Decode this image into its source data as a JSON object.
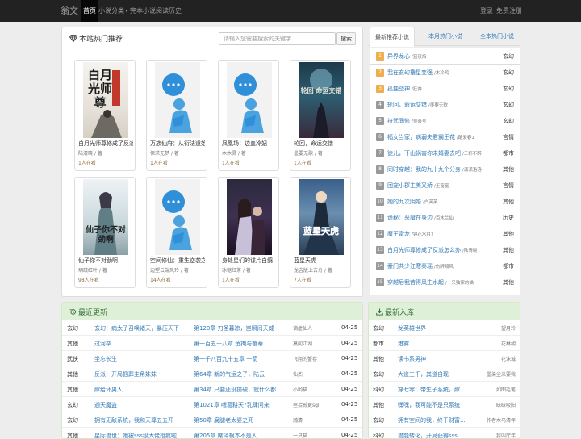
{
  "nav": {
    "brand": "翁文",
    "links": [
      "首页",
      "小说分类",
      "完本小说",
      "阅读历史"
    ],
    "login": "登录",
    "register": "免费注册"
  },
  "hot": {
    "title": "本站热门推荐",
    "search_placeholder": "请输入您需要搜索的关键字",
    "search_button": "搜索",
    "books": [
      {
        "title": "白月光师尊修成了反派么",
        "author": "陆清晓 / 著",
        "readers": "1人在看",
        "cover_text": "白月光师尊"
      },
      {
        "title": "万族仙府：从衍法道始",
        "author": "但求无梦 / 著",
        "readers": "1人在看",
        "cover_text": ""
      },
      {
        "title": "凤凰场：边血冷妃",
        "author": "木木灵 / 著",
        "readers": "1人在看",
        "cover_text": ""
      },
      {
        "title": "轮回，命运交错",
        "author": "墨要无歌 / 著",
        "readers": "1人在看",
        "cover_text": "轮回 命运交错"
      },
      {
        "title": "仙子你不对劲啊",
        "author": "玥疏红叶 / 著",
        "readers": "98人在看",
        "cover_text": "仙子你不对劲啊"
      },
      {
        "title": "空间修仙：重生逆袭之旅",
        "author": "边塑云端风玲 / 著",
        "readers": "14人在看",
        "cover_text": ""
      },
      {
        "title": "身处星们的谍片白鸽",
        "author": "冰糖红茶 / 著",
        "readers": "1人在看",
        "cover_text": ""
      },
      {
        "title": "蓝星天虎",
        "author": "龙吉版上古舟 / 著",
        "readers": "7人在看",
        "cover_text": "蓝星天虎"
      }
    ]
  },
  "rank": {
    "tabs": [
      "最新推荐小说",
      "本月热门小说",
      "全本热门小说"
    ],
    "items": [
      {
        "num": "1",
        "title": "异界龙心",
        "author": "/蓝夜焰",
        "cat": "玄幻"
      },
      {
        "num": "2",
        "title": "我在玄幻撸星变强",
        "author": "/木冷鸡",
        "cat": "玄幻"
      },
      {
        "num": "3",
        "title": "孤独战神",
        "author": "/狂奔",
        "cat": "玄幻"
      },
      {
        "num": "4",
        "title": "轮回，命运交错",
        "author": "/墨要无歌",
        "cat": "玄幻"
      },
      {
        "num": "5",
        "title": "符武同修",
        "author": "/良善号",
        "cat": "玄幻"
      },
      {
        "num": "6",
        "title": "福女当家，病弱夫君霸王花",
        "author": "/酷爱春1",
        "cat": "言情"
      },
      {
        "num": "7",
        "title": "徒儿，下山祸害你未婚妻去吧",
        "author": "/三杯不醉",
        "cat": "都市"
      },
      {
        "num": "8",
        "title": "同时穿越：我的九十九个分身",
        "author": "/潇潇洛洛",
        "cat": "其他"
      },
      {
        "num": "9",
        "title": "团宠小郡主美又娇",
        "author": "/王富富",
        "cat": "言情"
      },
      {
        "num": "10",
        "title": "她的九次阴婚",
        "author": "/白芙芙",
        "cat": "其他"
      },
      {
        "num": "11",
        "title": "诡秘：恶魔在身边",
        "author": "/百木兰仙",
        "cat": "历史"
      },
      {
        "num": "12",
        "title": "魔王雷龙",
        "author": "/镜花水月?",
        "cat": "其他"
      },
      {
        "num": "13",
        "title": "白月光师尊修成了反派怎么办",
        "author": "/陆清晓",
        "cat": "其他"
      },
      {
        "num": "14",
        "title": "豪门共少江寒秦瑶",
        "author": "/伤醉殴风",
        "cat": "都市"
      },
      {
        "num": "15",
        "title": "穿越后我苦得风生水起",
        "author": "/一只独家的猫",
        "cat": "其他"
      }
    ]
  },
  "updates": {
    "title": "最近更新",
    "rows": [
      {
        "cat": "玄幻",
        "title": "玄幻：病太子召唤诸天，暴压天下",
        "chapter": "第120章 刀圣暮凉，岂瞬间天威",
        "author": "谪虚仙人",
        "date": "04-25"
      },
      {
        "cat": "其他",
        "title": "过河卒",
        "chapter": "第一百五十八章 鱼掩与蟹蒂",
        "author": "莫问江湖",
        "date": "04-25"
      },
      {
        "cat": "武侠",
        "title": "坐忘长生",
        "chapter": "第一千八百九十五章 一箭",
        "author": "飞翔的蟹卷",
        "date": "04-25"
      },
      {
        "cat": "其他",
        "title": "反派：开局掴葬主角妹妹",
        "chapter": "第64章 新的气运之子，陆云",
        "author": "仙杰",
        "date": "04-25"
      },
      {
        "cat": "其他",
        "title": "嫁给坏男人",
        "chapter": "第34章 只要还没撞破，就什么都...",
        "author": "小哟猫",
        "date": "04-25"
      },
      {
        "cat": "玄幻",
        "title": "通天魔盗",
        "chapter": "第1021章 嗜葛耕天?乳肆问来",
        "author": "叁拾贰更sgl",
        "date": "04-25"
      },
      {
        "cat": "玄幻",
        "title": "拥有无敌系统，我和天尊五五开",
        "chapter": "第50章 腐腿老太婆之死",
        "author": "瀚清",
        "date": "04-25"
      },
      {
        "cat": "其他",
        "title": "星际兽世：她被sss级大佬抢疯啦!",
        "chapter": "第205章 席泽根本不是人",
        "author": "一只猫",
        "date": "04-25"
      }
    ]
  },
  "latest": {
    "title": "最新入库",
    "rows": [
      {
        "cat": "玄幻",
        "title": "龙英雄世界",
        "author": "望月玲"
      },
      {
        "cat": "都市",
        "title": "港雾",
        "author": "花林胡"
      },
      {
        "cat": "其他",
        "title": "读书系男神",
        "author": "花沫城"
      },
      {
        "cat": "玄幻",
        "title": "大道三千，其道自现",
        "author": "墨染尘米要我"
      },
      {
        "cat": "科幻",
        "title": "穿七零：带生子系统，嫁...",
        "author": "如图毛笔"
      },
      {
        "cat": "其他",
        "title": "嘿嘿，我可能不是只系统",
        "author": "昧昧吸阳"
      },
      {
        "cat": "玄幻",
        "title": "拥有空间的我，终于财富...",
        "author": "作者木马清年"
      },
      {
        "cat": "科幻",
        "title": "兽能转化，开局获得sss...",
        "author": "我叫厅年"
      }
    ]
  }
}
